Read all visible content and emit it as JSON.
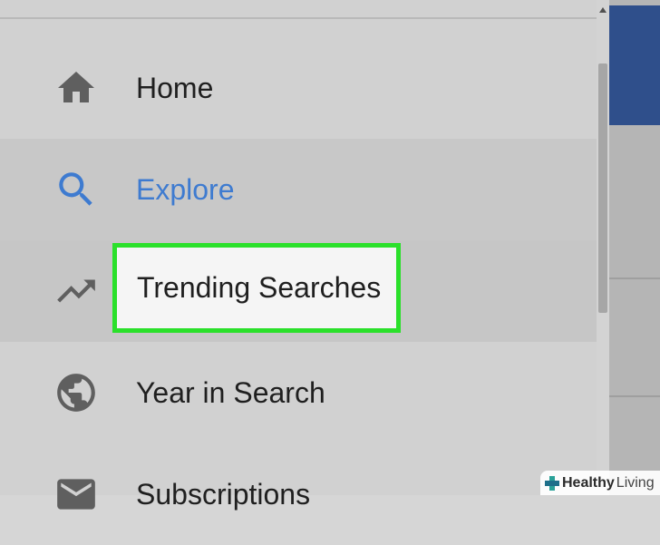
{
  "menu": {
    "items": [
      {
        "label": "Home",
        "icon": "home-icon"
      },
      {
        "label": "Explore",
        "icon": "search-icon",
        "active": true
      },
      {
        "label": "Trending Searches",
        "icon": "trending-up-icon",
        "highlighted": true
      },
      {
        "label": "Year in Search",
        "icon": "globe-icon"
      },
      {
        "label": "Subscriptions",
        "icon": "mail-icon"
      }
    ]
  },
  "colors": {
    "active_accent": "#3e7bd0",
    "highlight_border": "#2ae02a",
    "icon_gray": "#5f5f5f",
    "header_blue": "#2f4f8b"
  },
  "watermark": {
    "first": "Healthy",
    "second": "Living",
    "icon": "cross-icon"
  }
}
